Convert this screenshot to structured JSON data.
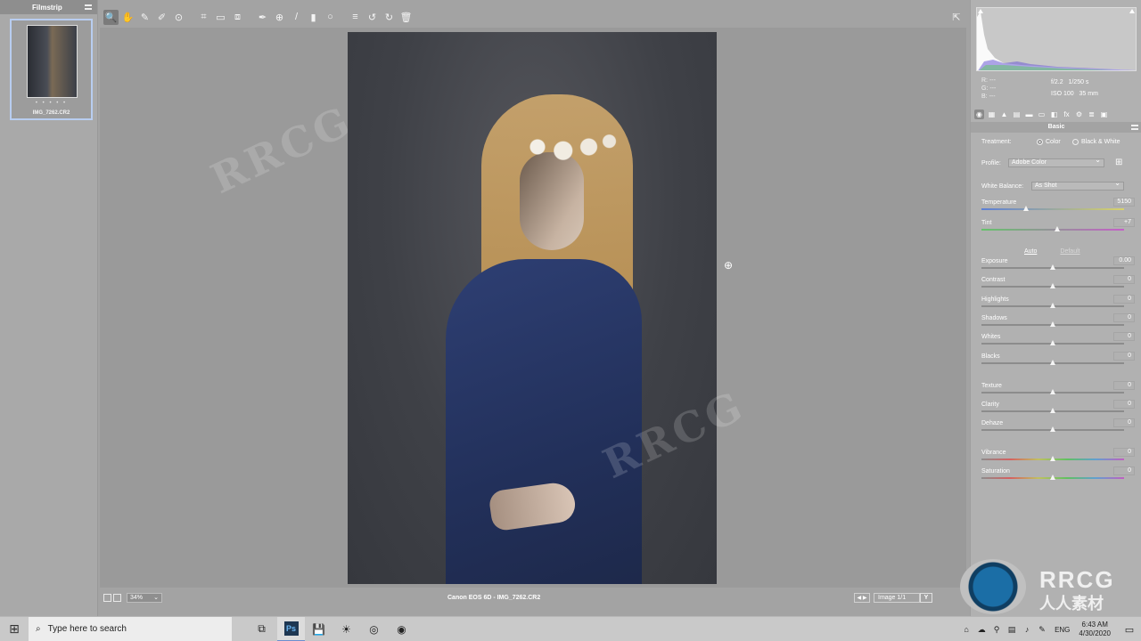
{
  "filmstrip": {
    "title": "Filmstrip",
    "thumbnail": {
      "filename": "IMG_7262.CR2",
      "stars": "• • • • •"
    }
  },
  "toolbar": {
    "tools": [
      {
        "name": "zoom-tool",
        "glyph": "🔍"
      },
      {
        "name": "hand-tool",
        "glyph": "✋"
      },
      {
        "name": "white-balance-tool",
        "glyph": "✎"
      },
      {
        "name": "color-sampler-tool",
        "glyph": "✐"
      },
      {
        "name": "targeted-adjustment-tool",
        "glyph": "⊙"
      },
      {
        "name": "crop-tool",
        "glyph": "⌗"
      },
      {
        "name": "straighten-tool",
        "glyph": "▭"
      },
      {
        "name": "transform-tool",
        "glyph": "⧈"
      },
      {
        "name": "spot-removal-tool",
        "glyph": "✒"
      },
      {
        "name": "red-eye-tool",
        "glyph": "⊕"
      },
      {
        "name": "adjustment-brush-tool",
        "glyph": "/"
      },
      {
        "name": "graduated-filter-tool",
        "glyph": "▮"
      },
      {
        "name": "radial-filter-tool",
        "glyph": "○"
      },
      {
        "name": "preferences-tool",
        "glyph": "≡"
      },
      {
        "name": "rotate-left-tool",
        "glyph": "↺"
      },
      {
        "name": "rotate-right-tool",
        "glyph": "↻"
      },
      {
        "name": "trash-tool",
        "glyph": "🗑"
      }
    ]
  },
  "status": {
    "zoom": "34%",
    "file_info": "Canon EOS 6D  -  IMG_7262.CR2",
    "image_count": "Image 1/1",
    "y_label": "Y"
  },
  "histogram": {
    "r_label": "R:",
    "g_label": "G:",
    "b_label": "B:",
    "r_value": "---",
    "g_value": "---",
    "b_value": "---",
    "aperture": "f/2.2",
    "shutter": "1/250 s",
    "iso": "ISO 100",
    "focal": "35 mm"
  },
  "panel": {
    "section_title": "Basic",
    "treatment_label": "Treatment:",
    "treatment_options": [
      "Color",
      "Black & White"
    ],
    "profile_label": "Profile:",
    "profile_value": "Adobe Color",
    "wb_label": "White Balance:",
    "wb_value": "As Shot",
    "auto_label": "Auto",
    "default_label": "Default",
    "sliders": [
      {
        "label": "Temperature",
        "value": "5150",
        "level": 0.31
      },
      {
        "label": "Tint",
        "value": "+7",
        "level": 0.53
      },
      {
        "label": "Exposure",
        "value": "0.00",
        "level": 0.5
      },
      {
        "label": "Contrast",
        "value": "0",
        "level": 0.5
      },
      {
        "label": "Highlights",
        "value": "0",
        "level": 0.5
      },
      {
        "label": "Shadows",
        "value": "0",
        "level": 0.5
      },
      {
        "label": "Whites",
        "value": "0",
        "level": 0.5
      },
      {
        "label": "Blacks",
        "value": "0",
        "level": 0.5
      },
      {
        "label": "Texture",
        "value": "0",
        "level": 0.5
      },
      {
        "label": "Clarity",
        "value": "0",
        "level": 0.5
      },
      {
        "label": "Dehaze",
        "value": "0",
        "level": 0.5
      },
      {
        "label": "Vibrance",
        "value": "0",
        "level": 0.5
      },
      {
        "label": "Saturation",
        "value": "0",
        "level": 0.5
      }
    ]
  },
  "watermark": {
    "text": "RRCG",
    "logo_text": "RRCG",
    "logo_sub": "人人素材"
  },
  "taskbar": {
    "search_placeholder": "Type here to search",
    "apps": [
      {
        "name": "task-view-icon",
        "glyph": "⧉"
      },
      {
        "name": "photoshop-icon",
        "glyph": "Ps"
      },
      {
        "name": "save-icon",
        "glyph": "💾"
      },
      {
        "name": "sun-app-icon",
        "glyph": "☀"
      },
      {
        "name": "camera-app-icon",
        "glyph": "◎"
      },
      {
        "name": "chrome-icon",
        "glyph": "◉"
      }
    ],
    "language": "ENG",
    "time": "6:43 AM",
    "date": "4/30/2020"
  }
}
